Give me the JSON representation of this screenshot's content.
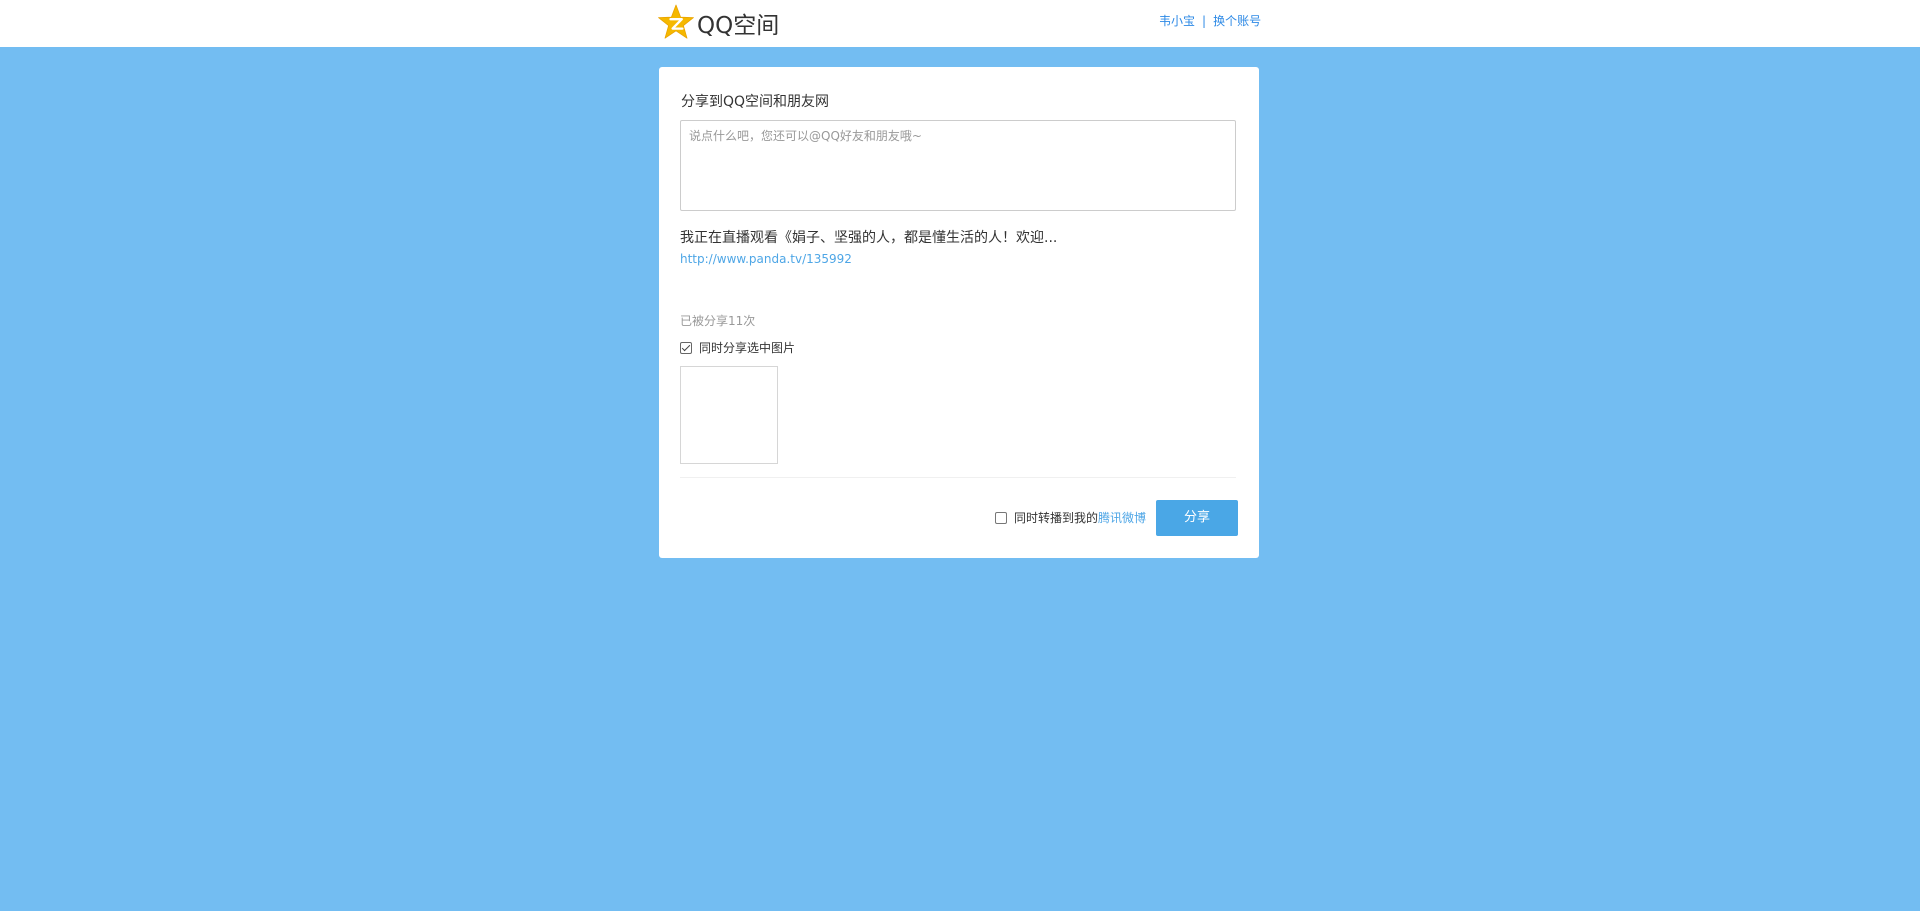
{
  "header": {
    "logo_text": "QQ空间",
    "logo_icon": "qzone-star-icon",
    "user_name": "韦小宝",
    "separator": "|",
    "switch_account": "换个账号"
  },
  "panel": {
    "title": "分享到QQ空间和朋友网",
    "comment": {
      "value": "",
      "placeholder": "说点什么吧，您还可以@QQ好友和朋友哦~"
    },
    "share_title": "我正在直播观看《娟子、坚强的人，都是懂生活的人！欢迎...",
    "share_url": "http://www.panda.tv/135992",
    "share_count_text": "已被分享11次",
    "share_image_option": {
      "label": "同时分享选中图片",
      "checked": true
    },
    "weibo_option": {
      "label_prefix": "同时转播到我的",
      "link_text": "腾讯微博",
      "checked": false
    },
    "share_button": "分享"
  },
  "colors": {
    "background": "#73bdf2",
    "accent": "#4aa7e6",
    "link": "#2e8ae6",
    "logo_star": "#f5b800"
  }
}
